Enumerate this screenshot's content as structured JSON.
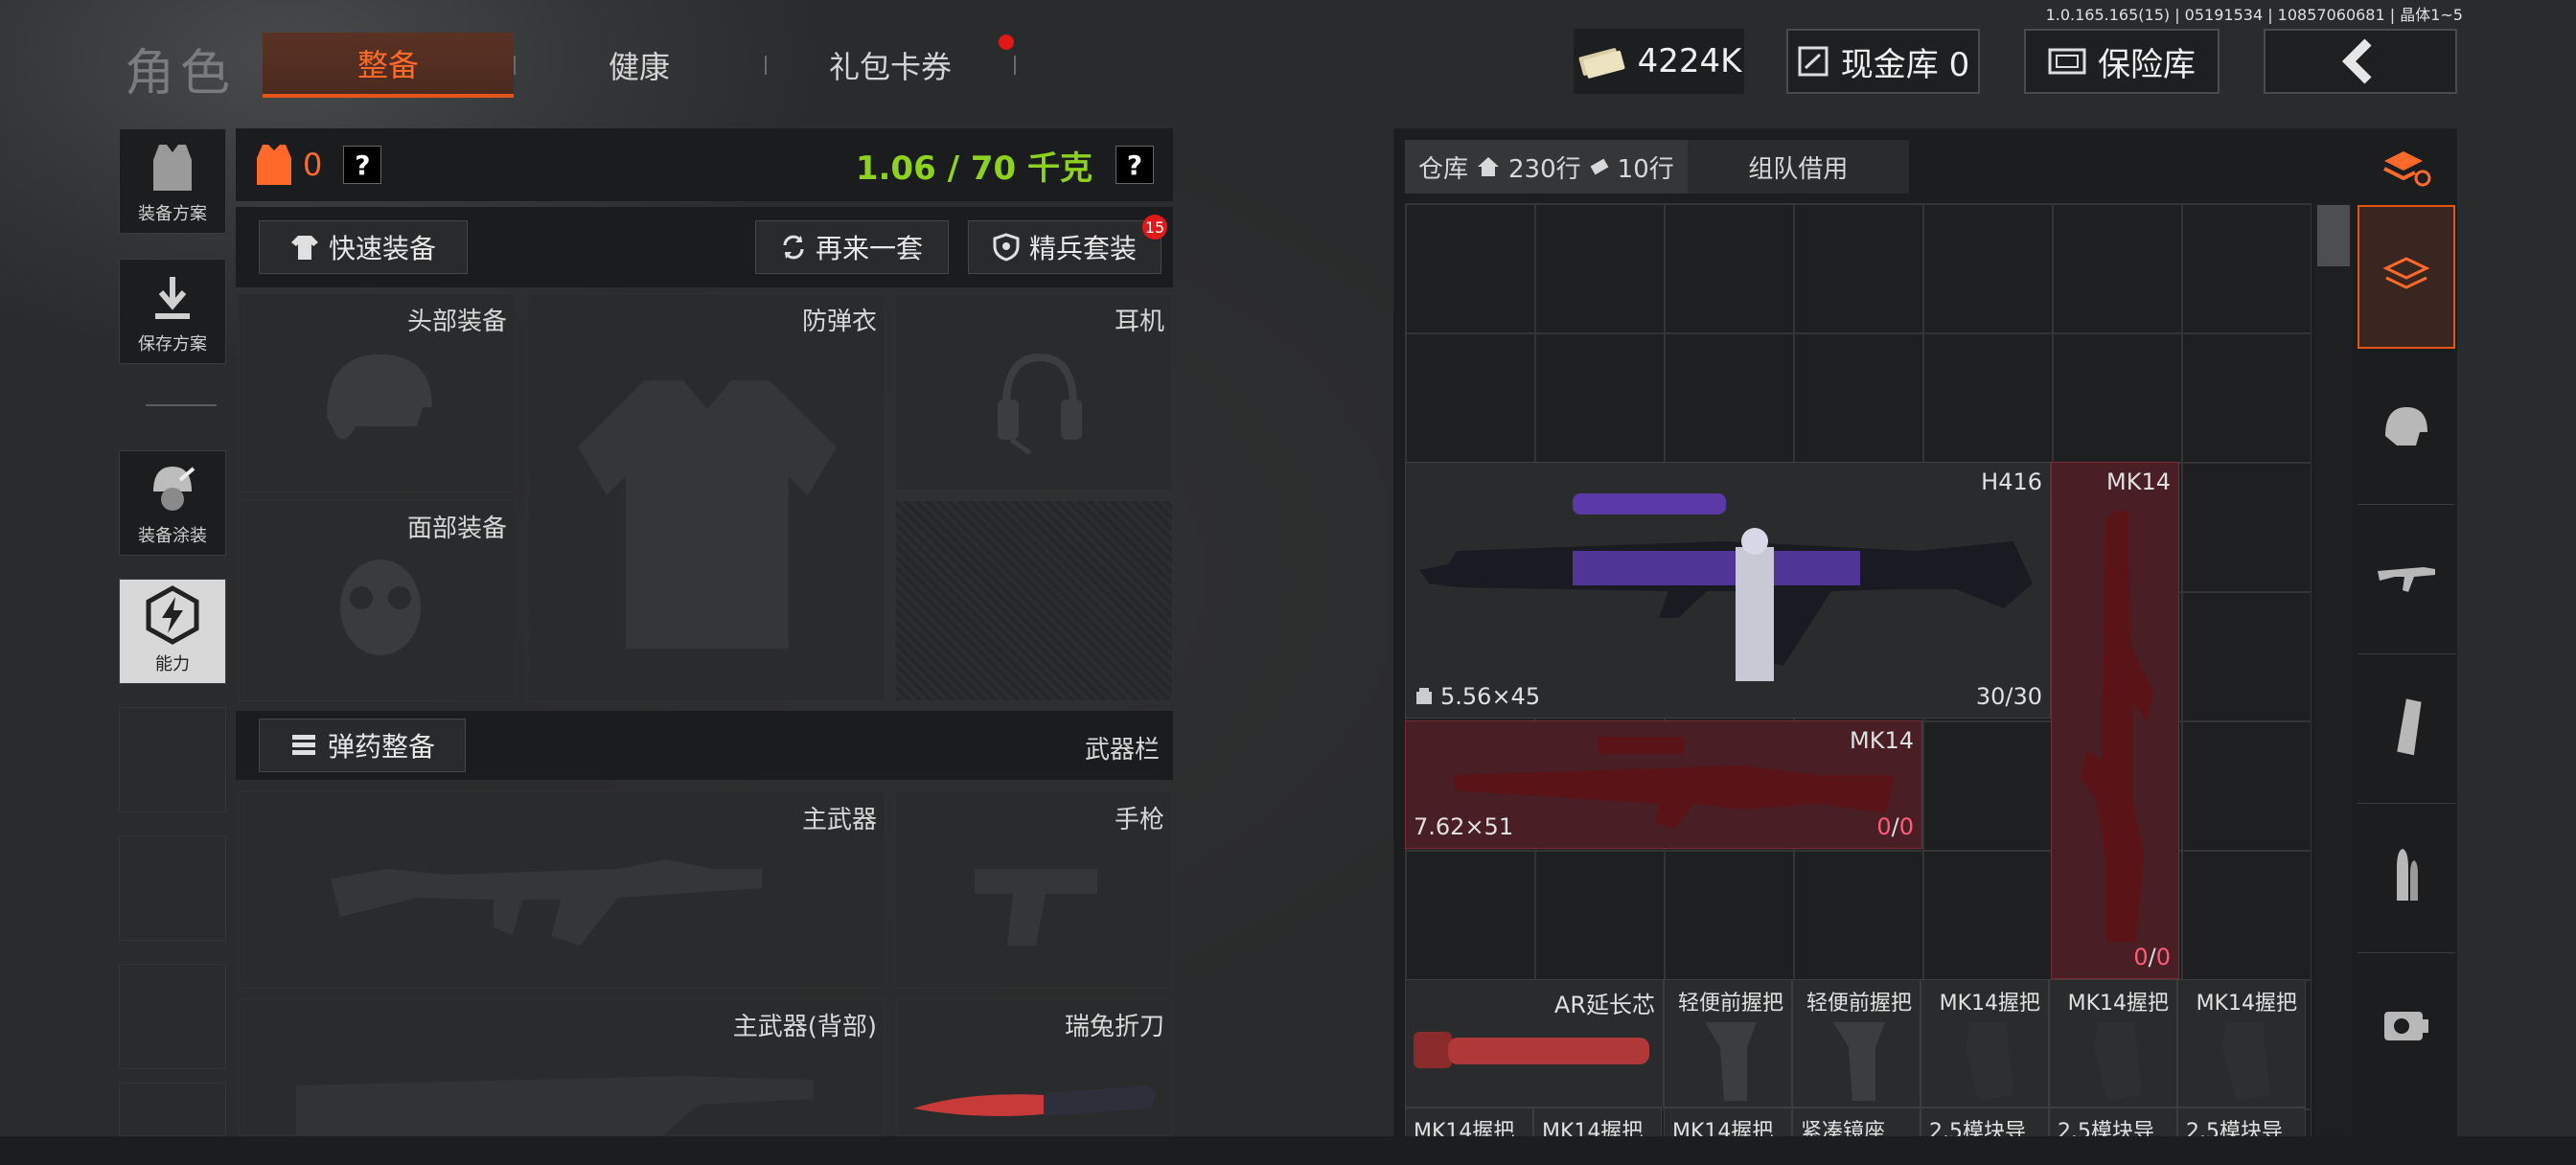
{
  "version": "1.0.165.165(15) | 05191534 | 10857060681 | 晶体1~5",
  "header": {
    "title": "角色",
    "tabs": [
      "整备",
      "健康",
      "礼包卡券"
    ],
    "money": "4224K",
    "cash_vault": "现金库 0",
    "safe_box": "保险库"
  },
  "left_nav": {
    "items": [
      "装备方案",
      "保存方案",
      "装备涂装",
      "能力"
    ]
  },
  "stats": {
    "armor_count": "0",
    "weight": "1.06 / 70 千克",
    "help": "?"
  },
  "actions": {
    "quick_equip": "快速装备",
    "again": "再来一套",
    "elite": "精兵套装",
    "elite_badge": "15",
    "ammo_equip": "弹药整备",
    "weapon_bar": "武器栏"
  },
  "slots": {
    "head": "头部装备",
    "armor": "防弹衣",
    "headset": "耳机",
    "face": "面部装备",
    "primary": "主武器",
    "pistol": "手枪",
    "primary_back": "主武器(背部)",
    "knife": "瑞兔折刀"
  },
  "storage": {
    "tab_label": "仓库",
    "rows_home": "230行",
    "rows_extra": "10行",
    "team_tab": "组队借用"
  },
  "items": [
    {
      "name": "H416",
      "caliber": "5.56×45",
      "ammo": "30/30"
    },
    {
      "name": "MK14",
      "caliber": "7.62×51",
      "ammo_cur": "0",
      "ammo_max": "0"
    },
    {
      "name": "MK14",
      "ammo_cur": "0",
      "ammo_max": "0"
    }
  ],
  "small_items": [
    "AR延长芯",
    "轻便前握把",
    "轻便前握把",
    "MK14握把",
    "MK14握把",
    "MK14握把"
  ],
  "bottom_items": [
    "MK14握把",
    "MK14握把",
    "MK14握把",
    "紧凑镜座",
    "2.5模块导",
    "2.5模块导",
    "2.5模块导"
  ],
  "colors": {
    "accent": "#e4551a",
    "weight": "#8fd11f",
    "red_item": "#4a1e25",
    "pink": "#ff5c7a"
  }
}
